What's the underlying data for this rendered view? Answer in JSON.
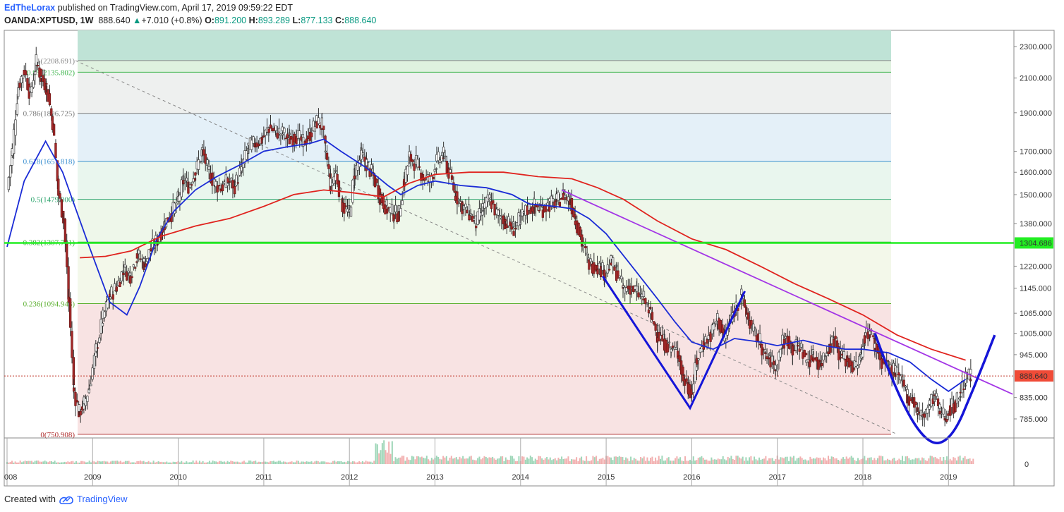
{
  "header": {
    "author": "EdTheLorax",
    "published_text": "published on TradingView.com, April 17, 2019 09:59:22 EDT",
    "symbol": "OANDA:XPTUSD, 1W",
    "last": "888.640",
    "change": "+7.010 (+0.8%)",
    "open_label": "O:",
    "open_value": "891.200",
    "high_label": "H:",
    "high_value": "893.289",
    "low_label": "L:",
    "low_value": "877.133",
    "close_label": "C:",
    "close_value": "888.640"
  },
  "footer": {
    "created_with": "Created with",
    "brand": "TradingView"
  },
  "colors": {
    "up": "#089981",
    "down": "#cc2f3c",
    "ma_blue": "#1a2bd6",
    "ma_red": "#e0231e",
    "trend_purple": "#a335e6",
    "pattern_blue": "#1515d8",
    "support_green": "#22ee22"
  },
  "chart_data": {
    "type": "candlestick",
    "symbol": "OANDA:XPTUSD",
    "timeframe": "1W",
    "x_axis_ticks": [
      "008",
      "2009",
      "2010",
      "2011",
      "2012",
      "2013",
      "2014",
      "2015",
      "2016",
      "2017",
      "2018",
      "2019"
    ],
    "y_axis_ticks": [
      "2300.000",
      "2100.000",
      "1900.000",
      "1700.000",
      "1600.000",
      "1500.000",
      "1380.000",
      "1304.686",
      "1220.000",
      "1145.000",
      "1065.000",
      "1005.000",
      "945.000",
      "888.640",
      "835.000",
      "785.000"
    ],
    "y_range": [
      650,
      2450
    ],
    "y_scale": "log",
    "volume_axis_tick": "0",
    "last_price_label": "888.640",
    "horizontal_level_label": "1304.686",
    "fibonacci_levels": [
      {
        "label": "1(2208.691)",
        "ratio": 1,
        "price": 2208.691
      },
      {
        "label": "0.95(2135.802)",
        "ratio": 0.95,
        "price": 2135.802
      },
      {
        "label": "0.786(1896.725)",
        "ratio": 0.786,
        "price": 1896.725
      },
      {
        "label": "0.618(1651.818)",
        "ratio": 0.618,
        "price": 1651.818
      },
      {
        "label": "0.5(1479.800)",
        "ratio": 0.5,
        "price": 1479.8
      },
      {
        "label": "0.382(1307.781)",
        "ratio": 0.382,
        "price": 1307.781
      },
      {
        "label": "0.236(1094.943)",
        "ratio": 0.236,
        "price": 1094.943
      },
      {
        "label": "0(750.908)",
        "ratio": 0,
        "price": 750.908
      }
    ],
    "price_path": [
      [
        2008.0,
        1520
      ],
      [
        2008.06,
        1700
      ],
      [
        2008.13,
        2050
      ],
      [
        2008.2,
        2150
      ],
      [
        2008.27,
        2000
      ],
      [
        2008.34,
        2200
      ],
      [
        2008.4,
        2100
      ],
      [
        2008.46,
        2050
      ],
      [
        2008.53,
        1850
      ],
      [
        2008.6,
        1500
      ],
      [
        2008.66,
        1400
      ],
      [
        2008.72,
        1100
      ],
      [
        2008.78,
        850
      ],
      [
        2008.84,
        800
      ],
      [
        2008.9,
        820
      ],
      [
        2008.96,
        860
      ],
      [
        2009.04,
        960
      ],
      [
        2009.12,
        1050
      ],
      [
        2009.2,
        1120
      ],
      [
        2009.28,
        1150
      ],
      [
        2009.36,
        1210
      ],
      [
        2009.44,
        1190
      ],
      [
        2009.52,
        1260
      ],
      [
        2009.6,
        1230
      ],
      [
        2009.68,
        1280
      ],
      [
        2009.76,
        1320
      ],
      [
        2009.84,
        1380
      ],
      [
        2009.92,
        1420
      ],
      [
        2010.0,
        1480
      ],
      [
        2010.06,
        1560
      ],
      [
        2010.12,
        1540
      ],
      [
        2010.2,
        1600
      ],
      [
        2010.28,
        1700
      ],
      [
        2010.34,
        1620
      ],
      [
        2010.42,
        1550
      ],
      [
        2010.5,
        1530
      ],
      [
        2010.58,
        1560
      ],
      [
        2010.66,
        1540
      ],
      [
        2010.74,
        1620
      ],
      [
        2010.82,
        1720
      ],
      [
        2010.9,
        1740
      ],
      [
        2010.98,
        1760
      ],
      [
        2011.06,
        1820
      ],
      [
        2011.14,
        1800
      ],
      [
        2011.22,
        1790
      ],
      [
        2011.3,
        1760
      ],
      [
        2011.38,
        1780
      ],
      [
        2011.46,
        1740
      ],
      [
        2011.54,
        1790
      ],
      [
        2011.62,
        1850
      ],
      [
        2011.68,
        1830
      ],
      [
        2011.72,
        1700
      ],
      [
        2011.78,
        1540
      ],
      [
        2011.84,
        1600
      ],
      [
        2011.92,
        1450
      ],
      [
        2012.0,
        1420
      ],
      [
        2012.06,
        1600
      ],
      [
        2012.14,
        1680
      ],
      [
        2012.2,
        1640
      ],
      [
        2012.28,
        1580
      ],
      [
        2012.36,
        1490
      ],
      [
        2012.44,
        1440
      ],
      [
        2012.52,
        1420
      ],
      [
        2012.58,
        1420
      ],
      [
        2012.64,
        1560
      ],
      [
        2012.7,
        1670
      ],
      [
        2012.78,
        1640
      ],
      [
        2012.86,
        1580
      ],
      [
        2012.94,
        1560
      ],
      [
        2013.02,
        1650
      ],
      [
        2013.1,
        1680
      ],
      [
        2013.16,
        1600
      ],
      [
        2013.24,
        1500
      ],
      [
        2013.32,
        1450
      ],
      [
        2013.4,
        1420
      ],
      [
        2013.48,
        1380
      ],
      [
        2013.56,
        1440
      ],
      [
        2013.64,
        1480
      ],
      [
        2013.72,
        1420
      ],
      [
        2013.82,
        1390
      ],
      [
        2013.92,
        1360
      ],
      [
        2014.0,
        1400
      ],
      [
        2014.08,
        1440
      ],
      [
        2014.16,
        1450
      ],
      [
        2014.26,
        1440
      ],
      [
        2014.34,
        1460
      ],
      [
        2014.42,
        1470
      ],
      [
        2014.5,
        1500
      ],
      [
        2014.58,
        1470
      ],
      [
        2014.64,
        1400
      ],
      [
        2014.72,
        1300
      ],
      [
        2014.8,
        1230
      ],
      [
        2014.9,
        1220
      ],
      [
        2014.98,
        1200
      ],
      [
        2015.06,
        1230
      ],
      [
        2015.12,
        1200
      ],
      [
        2015.2,
        1140
      ],
      [
        2015.28,
        1150
      ],
      [
        2015.36,
        1130
      ],
      [
        2015.44,
        1110
      ],
      [
        2015.52,
        1060
      ],
      [
        2015.6,
        1000
      ],
      [
        2015.68,
        980
      ],
      [
        2015.76,
        960
      ],
      [
        2015.84,
        950
      ],
      [
        2015.9,
        880
      ],
      [
        2015.96,
        860
      ],
      [
        2016.0,
        850
      ],
      [
        2016.06,
        930
      ],
      [
        2016.14,
        980
      ],
      [
        2016.22,
        1000
      ],
      [
        2016.3,
        1050
      ],
      [
        2016.38,
        990
      ],
      [
        2016.46,
        1050
      ],
      [
        2016.52,
        1090
      ],
      [
        2016.58,
        1120
      ],
      [
        2016.64,
        1060
      ],
      [
        2016.72,
        1010
      ],
      [
        2016.8,
        980
      ],
      [
        2016.86,
        940
      ],
      [
        2016.92,
        930
      ],
      [
        2016.98,
        910
      ],
      [
        2017.06,
        980
      ],
      [
        2017.12,
        990
      ],
      [
        2017.18,
        960
      ],
      [
        2017.26,
        970
      ],
      [
        2017.34,
        930
      ],
      [
        2017.42,
        940
      ],
      [
        2017.5,
        920
      ],
      [
        2017.58,
        960
      ],
      [
        2017.66,
        990
      ],
      [
        2017.74,
        940
      ],
      [
        2017.82,
        930
      ],
      [
        2017.9,
        910
      ],
      [
        2017.98,
        940
      ],
      [
        2018.02,
        1000
      ],
      [
        2018.08,
        1010
      ],
      [
        2018.14,
        970
      ],
      [
        2018.22,
        930
      ],
      [
        2018.3,
        910
      ],
      [
        2018.38,
        900
      ],
      [
        2018.46,
        870
      ],
      [
        2018.52,
        840
      ],
      [
        2018.58,
        830
      ],
      [
        2018.64,
        800
      ],
      [
        2018.7,
        790
      ],
      [
        2018.78,
        820
      ],
      [
        2018.84,
        840
      ],
      [
        2018.9,
        800
      ],
      [
        2018.96,
        790
      ],
      [
        2019.02,
        810
      ],
      [
        2019.08,
        820
      ],
      [
        2019.14,
        850
      ],
      [
        2019.2,
        880
      ],
      [
        2019.26,
        889
      ]
    ],
    "moving_averages": [
      {
        "color": "blue",
        "points": [
          [
            2008.0,
            1290
          ],
          [
            2008.2,
            1560
          ],
          [
            2008.45,
            1750
          ],
          [
            2008.65,
            1600
          ],
          [
            2008.95,
            1300
          ],
          [
            2009.2,
            1100
          ],
          [
            2009.4,
            1060
          ],
          [
            2009.55,
            1150
          ],
          [
            2009.75,
            1320
          ],
          [
            2009.95,
            1430
          ],
          [
            2010.2,
            1520
          ],
          [
            2010.45,
            1580
          ],
          [
            2010.7,
            1630
          ],
          [
            2011.0,
            1700
          ],
          [
            2011.25,
            1720
          ],
          [
            2011.55,
            1740
          ],
          [
            2011.7,
            1760
          ],
          [
            2011.9,
            1700
          ],
          [
            2012.2,
            1620
          ],
          [
            2012.45,
            1540
          ],
          [
            2012.6,
            1500
          ],
          [
            2012.8,
            1540
          ],
          [
            2013.0,
            1560
          ],
          [
            2013.3,
            1540
          ],
          [
            2013.6,
            1530
          ],
          [
            2013.9,
            1500
          ],
          [
            2014.1,
            1460
          ],
          [
            2014.4,
            1450
          ],
          [
            2014.6,
            1440
          ],
          [
            2014.8,
            1400
          ],
          [
            2015.0,
            1340
          ],
          [
            2015.3,
            1220
          ],
          [
            2015.6,
            1110
          ],
          [
            2015.8,
            1040
          ],
          [
            2016.0,
            980
          ],
          [
            2016.25,
            960
          ],
          [
            2016.5,
            990
          ],
          [
            2016.8,
            980
          ],
          [
            2017.0,
            970
          ],
          [
            2017.3,
            985
          ],
          [
            2017.55,
            970
          ],
          [
            2017.8,
            960
          ],
          [
            2018.0,
            960
          ],
          [
            2018.3,
            950
          ],
          [
            2018.55,
            925
          ],
          [
            2018.8,
            880
          ],
          [
            2019.0,
            850
          ],
          [
            2019.2,
            880
          ]
        ]
      },
      {
        "color": "red",
        "points": [
          [
            2008.85,
            1250
          ],
          [
            2009.15,
            1255
          ],
          [
            2009.45,
            1275
          ],
          [
            2009.8,
            1330
          ],
          [
            2010.2,
            1370
          ],
          [
            2010.6,
            1400
          ],
          [
            2011.0,
            1450
          ],
          [
            2011.35,
            1500
          ],
          [
            2011.7,
            1520
          ],
          [
            2012.0,
            1510
          ],
          [
            2012.4,
            1490
          ],
          [
            2012.7,
            1550
          ],
          [
            2013.0,
            1590
          ],
          [
            2013.4,
            1600
          ],
          [
            2013.8,
            1600
          ],
          [
            2014.2,
            1580
          ],
          [
            2014.6,
            1570
          ],
          [
            2014.9,
            1530
          ],
          [
            2015.2,
            1480
          ],
          [
            2015.6,
            1390
          ],
          [
            2016.0,
            1320
          ],
          [
            2016.4,
            1280
          ],
          [
            2016.8,
            1220
          ],
          [
            2017.2,
            1160
          ],
          [
            2017.6,
            1110
          ],
          [
            2018.0,
            1060
          ],
          [
            2018.4,
            1000
          ],
          [
            2018.8,
            960
          ],
          [
            2019.2,
            930
          ]
        ]
      }
    ],
    "annotations": {
      "fib_dashed_line": [
        [
          2008.8,
          2208.691
        ],
        [
          2018.4,
          750.908
        ]
      ],
      "descending_trendline": [
        [
          2014.48,
          1520
        ],
        [
          2019.75,
          843
        ]
      ],
      "horizontal_level": 1304.686,
      "last_price_dotted_line": 888.64,
      "v_pattern": [
        [
          2014.96,
          1185
        ],
        [
          2015.98,
          810
        ],
        [
          2016.62,
          1135
        ]
      ],
      "cup_curve": [
        [
          2018.14,
          1005
        ],
        [
          2018.4,
          840
        ],
        [
          2018.76,
          726
        ],
        [
          2019.04,
          740
        ],
        [
          2019.3,
          860
        ],
        [
          2019.54,
          1000
        ]
      ]
    }
  }
}
